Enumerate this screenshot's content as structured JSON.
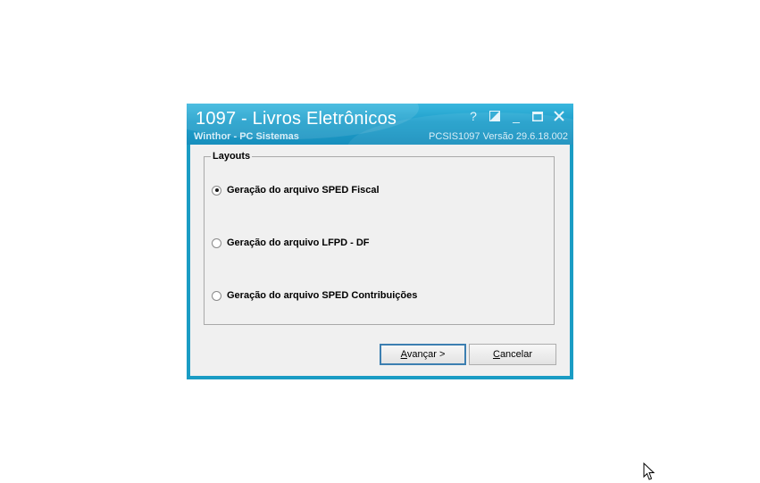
{
  "window": {
    "title": "1097 - Livros Eletrônicos",
    "subtitle": "Winthor - PC Sistemas",
    "version": "PCSIS1097  Versão  29.6.18.002",
    "controls": {
      "help": "?",
      "minimize": "_"
    }
  },
  "layouts": {
    "group_title": "Layouts",
    "options": [
      {
        "label": "Geração do arquivo SPED Fiscal",
        "checked": true
      },
      {
        "label": "Geração do arquivo LFPD - DF",
        "checked": false
      },
      {
        "label": "Geração do arquivo SPED Contribuições",
        "checked": false
      }
    ]
  },
  "buttons": {
    "next_mnemonic": "A",
    "next_rest": "vançar >",
    "cancel_mnemonic": "C",
    "cancel_rest": "ancelar"
  }
}
